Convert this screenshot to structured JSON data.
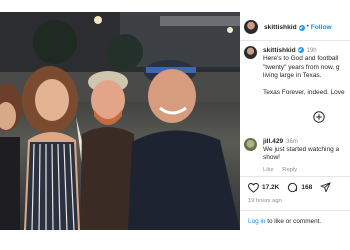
{
  "post": {
    "username": "skittishkid",
    "follow_label": "Follow",
    "caption_time": "19h",
    "caption_lines": [
      "Here's to God and football",
      "\"twenty\" years from now, g",
      "living large in Texas."
    ],
    "caption_second": "Texas Forever, indeed. Love",
    "comment": {
      "username": "jill.429",
      "time": "36m",
      "text_lines": [
        "We just started watching a",
        "show!"
      ],
      "like_label": "Like",
      "reply_label": "Reply"
    },
    "likes": "17.2K",
    "comments_count": "168",
    "posted_ago": "19 hours ago",
    "login_link": "Log in",
    "login_rest": " to like or comment."
  },
  "icons": [
    "verified-badge",
    "more-plus-circle",
    "heart",
    "comment-bubble",
    "share-arrow"
  ],
  "colors": {
    "link_blue": "#0095f6",
    "muted_gray": "#8e8e8e",
    "verified": "#1d9bf0"
  }
}
